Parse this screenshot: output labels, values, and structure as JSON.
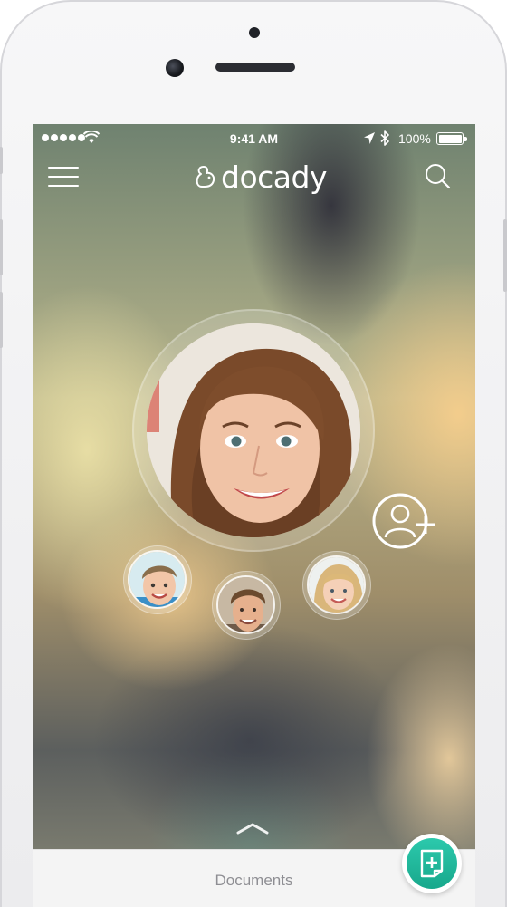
{
  "status_bar": {
    "time": "9:41 AM",
    "battery_percent": "100%",
    "signal_icon": "signal-dots-icon",
    "wifi_icon": "wifi-icon",
    "location_icon": "location-arrow-icon",
    "bluetooth_icon": "bluetooth-icon",
    "battery_icon": "battery-full-icon"
  },
  "header": {
    "menu_icon": "hamburger-menu-icon",
    "logo_text": "docady",
    "logo_icon": "squirrel-logo-icon",
    "search_icon": "search-icon"
  },
  "profiles": {
    "main": {
      "avatar": "woman-portrait"
    },
    "members": [
      {
        "avatar": "boy-portrait"
      },
      {
        "avatar": "man-portrait"
      },
      {
        "avatar": "girl-portrait"
      }
    ],
    "add_icon": "add-person-icon"
  },
  "pull_up_icon": "chevron-up-icon",
  "bottom_bar": {
    "label": "Documents"
  },
  "fab": {
    "icon": "add-document-icon",
    "color": "#1fb99c"
  }
}
